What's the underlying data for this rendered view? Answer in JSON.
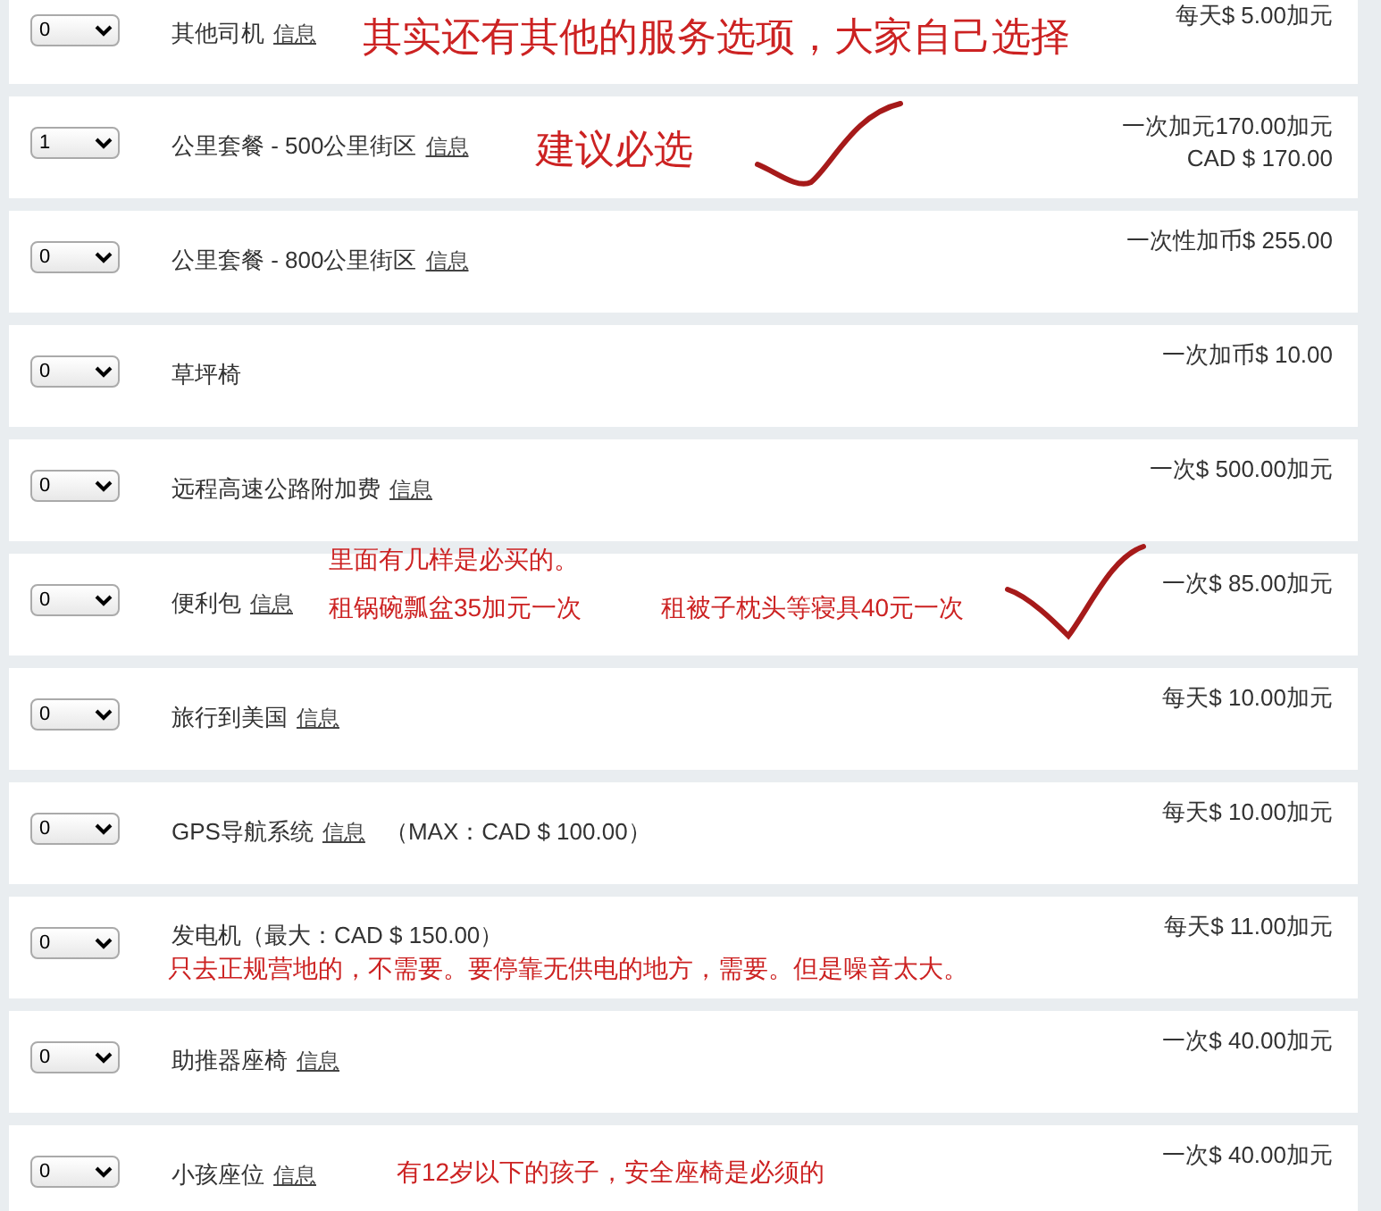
{
  "options": [
    {
      "qty": "0",
      "name": "其他司机",
      "info": "信息",
      "price": [
        "每天$ 5.00加元"
      ]
    },
    {
      "qty": "1",
      "name": "公里套餐 - 500公里街区",
      "info": "信息",
      "price": [
        "一次加元170.00加元",
        "CAD $ 170.00"
      ]
    },
    {
      "qty": "0",
      "name": "公里套餐 - 800公里街区",
      "info": "信息",
      "price": [
        "一次性加币$ 255.00"
      ]
    },
    {
      "qty": "0",
      "name": "草坪椅",
      "price": [
        "一次加币$ 10.00"
      ]
    },
    {
      "qty": "0",
      "name": "远程高速公路附加费",
      "info": "信息",
      "price": [
        "一次$ 500.00加元"
      ]
    },
    {
      "qty": "0",
      "name": "便利包",
      "info": "信息",
      "price": [
        "一次$ 85.00加元"
      ]
    },
    {
      "qty": "0",
      "name": "旅行到美国",
      "info": "信息",
      "price": [
        "每天$ 10.00加元"
      ]
    },
    {
      "qty": "0",
      "name": "GPS导航系统",
      "info": "信息",
      "suffix": "（MAX：CAD $ 100.00）",
      "price": [
        "每天$ 10.00加元"
      ]
    },
    {
      "qty": "0",
      "name": "发电机（最大：CAD $ 150.00）",
      "note": "只去正规营地的，不需要。要停靠无供电的地方，需要。但是噪音太大。",
      "price": [
        "每天$ 11.00加元"
      ]
    },
    {
      "qty": "0",
      "name": "助推器座椅",
      "info": "信息",
      "price": [
        "一次$ 40.00加元"
      ]
    },
    {
      "qty": "0",
      "name": "小孩座位",
      "info": "信息",
      "price": [
        "一次$ 40.00加元"
      ]
    }
  ],
  "annotations": [
    {
      "text": "其实还有其他的服务选项，大家自己选择",
      "kind": "big"
    },
    {
      "text": "建议必选",
      "kind": "big"
    },
    {
      "text": "里面有几样是必买的。",
      "kind": "small"
    },
    {
      "text": "租锅碗瓢盆35加元一次",
      "kind": "small"
    },
    {
      "text": "租被子枕头等寝具40元一次",
      "kind": "small"
    },
    {
      "text": "有12岁以下的孩子，安全座椅是必须的",
      "kind": "small"
    }
  ]
}
